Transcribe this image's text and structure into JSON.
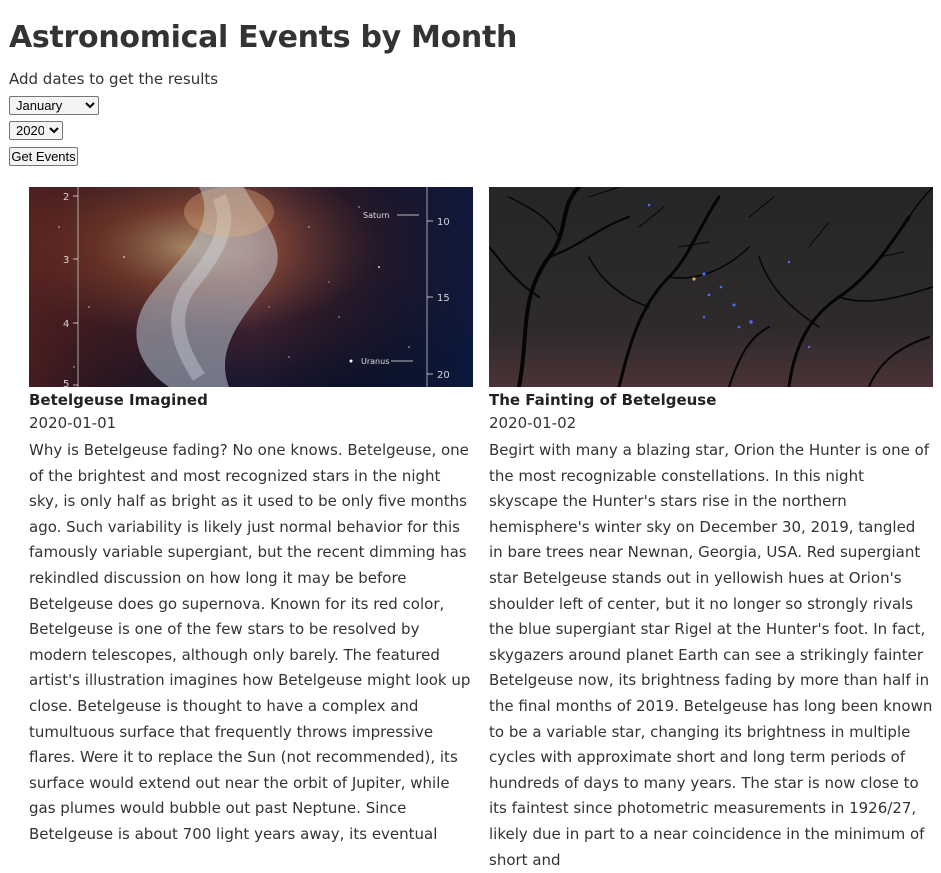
{
  "page": {
    "title": "Astronomical Events by Month",
    "subtitle": "Add dates to get the results"
  },
  "controls": {
    "month_selected": "January",
    "month_options": [
      "January"
    ],
    "year_selected": "2020",
    "year_options": [
      "2020"
    ],
    "button_label": "Get Events"
  },
  "events": [
    {
      "title": "Betelgeuse Imagined",
      "date": "2020-01-01",
      "image_labels": {
        "left_ticks": [
          "2",
          "3",
          "4",
          "5"
        ],
        "right_ticks": [
          "10",
          "15",
          "20"
        ],
        "saturn": "Saturn",
        "uranus": "Uranus"
      },
      "explanation": "Why is Betelgeuse fading? No one knows. Betelgeuse, one of the brightest and most recognized stars in the night sky, is only half as bright as it used to be only five months ago. Such variability is likely just normal behavior for this famously variable supergiant, but the recent dimming has rekindled discussion on how long it may be before Betelgeuse does go supernova. Known for its red color, Betelgeuse is one of the few stars to be resolved by modern telescopes, although only barely. The featured artist's illustration imagines how Betelgeuse might look up close. Betelgeuse is thought to have a complex and tumultuous surface that frequently throws impressive flares. Were it to replace the Sun (not recommended), its surface would extend out near the orbit of Jupiter, while gas plumes would bubble out past Neptune. Since Betelgeuse is about 700 light years away, its eventual"
    },
    {
      "title": "The Fainting of Betelgeuse",
      "date": "2020-01-02",
      "explanation": "Begirt with many a blazing star, Orion the Hunter is one of the most recognizable constellations. In this night skyscape the Hunter's stars rise in the northern hemisphere's winter sky on December 30, 2019, tangled in bare trees near Newnan, Georgia, USA. Red supergiant star Betelgeuse stands out in yellowish hues at Orion's shoulder left of center, but it no longer so strongly rivals the blue supergiant star Rigel at the Hunter's foot. In fact, skygazers around planet Earth can see a strikingly fainter Betelgeuse now, its brightness fading by more than half in the final months of 2019. Betelgeuse has long been known to be a variable star, changing its brightness in multiple cycles with approximate short and long term periods of hundreds of days to many years. The star is now close to its faintest since photometric measurements in 1926/27, likely due in part to a near coincidence in the minimum of short and"
    }
  ]
}
